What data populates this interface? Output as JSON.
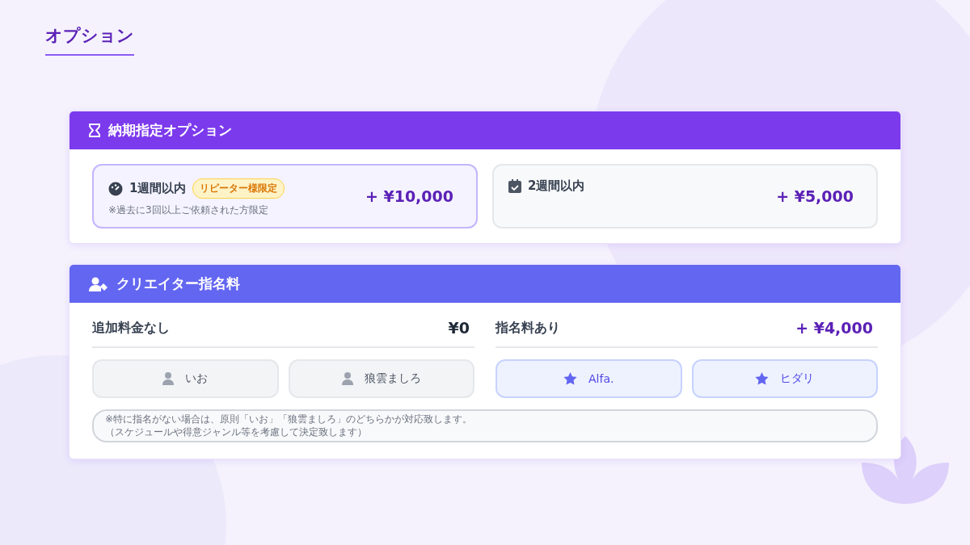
{
  "page_title": "オプション",
  "delivery": {
    "title": "納期指定オプション",
    "options": [
      {
        "kind": "fast",
        "label": "1週間以内",
        "badge": "リピーター様限定",
        "note": "※過去に3回以上ご依頼された方限定",
        "price": "+ ¥10,000",
        "selected": true
      },
      {
        "kind": "normal",
        "label": "2週間以内",
        "price": "+ ¥5,000",
        "selected": false
      }
    ]
  },
  "creator": {
    "title": "クリエイター指名料",
    "groups": [
      {
        "kind": "free",
        "label": "追加料金なし",
        "price": "¥0",
        "creators": [
          "いお",
          "狼雲ましろ"
        ]
      },
      {
        "kind": "paid",
        "label": "指名料あり",
        "price": "+ ¥4,000",
        "creators": [
          "Alfa.",
          "ヒダリ"
        ]
      }
    ],
    "note": [
      "※特に指名がない場合は、原則「いお」「狼雲ましろ」のどちらかが対応致します。",
      "（スケジュールや得意ジャンル等を考慮して決定致します）"
    ]
  }
}
